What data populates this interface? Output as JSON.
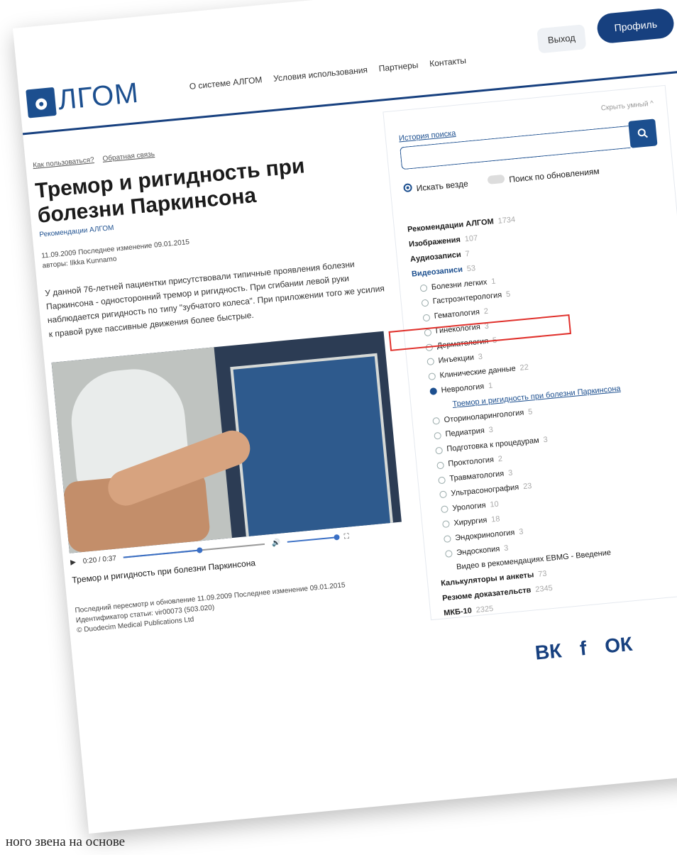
{
  "header": {
    "logo_text": "ЛГОМ",
    "nav": [
      "О системе АЛГОМ",
      "Условия использования",
      "Партнеры",
      "Контакты"
    ],
    "logout_label": "Выход",
    "profile_label": "Профиль"
  },
  "article": {
    "meta_links": [
      "Как пользоваться?",
      "Обратная связь"
    ],
    "title": "Тремор и ригидность при болезни Паркинсона",
    "breadcrumb": "Рекомендации АЛГОМ",
    "date_line": "11.09.2009 Последнее изменение 09.01.2015",
    "author_line": "авторы: Ilkka Kunnamo",
    "description": "У данной 76-летней пациентки присутствовали типичные проявления болезни Паркинсона - односторонний тремор и ригидность. При сгибании левой руки наблюдается ригидность по типу \"зубчатого колеса\". При приложении того же усилия к правой руке пассивные движения более быстрые.",
    "video_time": "0:20 / 0:37",
    "video_progress": 0.54,
    "video_caption": "Тремор и ригидность при болезни Паркинсона",
    "footer_lines": [
      "Последний пересмотр и обновление 11.09.2009 Последнее изменение 09.01.2015",
      "Идентификатор статьи: vir00073 (503.020)",
      "© Duodecim Medical Publications Ltd"
    ]
  },
  "sidebar": {
    "hide_filters": "Скрыть умный ^",
    "history_link": "История поиска",
    "search_placeholder": "",
    "radio_everywhere": "Искать везде",
    "radio_updates": "Поиск по обновлениям",
    "categories": [
      {
        "label": "Рекомендации АЛГОМ",
        "count": "1734"
      },
      {
        "label": "Изображения",
        "count": "107"
      },
      {
        "label": "Аудиозаписи",
        "count": "7"
      },
      {
        "label": "Видеозаписи",
        "count": "53"
      }
    ],
    "video_subs": [
      {
        "label": "Болезни легких",
        "count": "1"
      },
      {
        "label": "Гастроэнтерология",
        "count": "5"
      },
      {
        "label": "Гематология",
        "count": "2"
      },
      {
        "label": "Гинекология",
        "count": "3"
      },
      {
        "label": "Дерматология",
        "count": "5"
      },
      {
        "label": "Инъекции",
        "count": "3"
      },
      {
        "label": "Клинические данные",
        "count": "22"
      },
      {
        "label": "Неврология",
        "count": "1"
      }
    ],
    "neuro_link": "Тремор и ригидность при болезни Паркинсона",
    "video_subs_2": [
      {
        "label": "Оториноларингология",
        "count": "5"
      },
      {
        "label": "Педиатрия",
        "count": "3"
      },
      {
        "label": "Подготовка к процедурам",
        "count": "3"
      },
      {
        "label": "Проктология",
        "count": "2"
      },
      {
        "label": "Травматология",
        "count": "3"
      },
      {
        "label": "Ультрасонография",
        "count": "23"
      },
      {
        "label": "Урология",
        "count": "10"
      },
      {
        "label": "Хирургия",
        "count": "18"
      },
      {
        "label": "Эндокринология",
        "count": "3"
      },
      {
        "label": "Эндоскопия",
        "count": "3"
      }
    ],
    "ebmg_line": "Видео в рекомендациях EBMG - Введение",
    "tail": [
      {
        "label": "Калькуляторы и анкеты",
        "count": "73"
      },
      {
        "label": "Резюме доказательств",
        "count": "2345"
      },
      {
        "label": "МКБ-10",
        "count": "2325"
      }
    ]
  },
  "socials": [
    "ВК",
    "f",
    "ОК"
  ],
  "bottom_text": "ного звена на основе"
}
